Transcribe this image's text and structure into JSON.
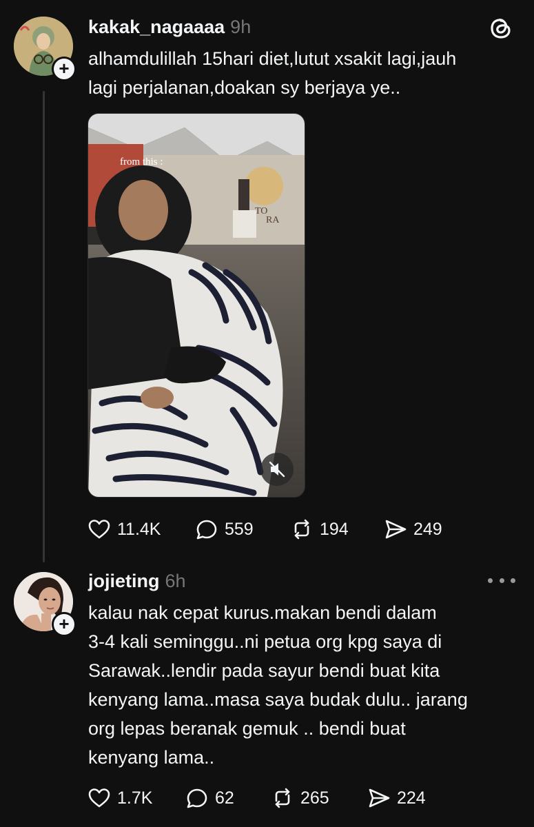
{
  "post": {
    "username": "kakak_nagaaaa",
    "time": "9h",
    "text_lines": [
      "alhamdulillah 15hari diet,lutut xsakit lagi,jauh",
      "lagi perjalanan,doakan sy berjaya ye.."
    ],
    "video": {
      "caption": "from this :",
      "sign_text_1": "TO",
      "sign_text_2": "RA"
    },
    "actions": {
      "likes": "11.4K",
      "comments": "559",
      "reposts": "194",
      "shares": "249"
    }
  },
  "reply": {
    "username": "jojieting",
    "time": "6h",
    "text_lines": [
      "kalau nak cepat kurus.makan bendi dalam",
      "3-4 kali seminggu..ni petua org kpg saya di",
      "Sarawak..lendir pada sayur bendi buat kita",
      "kenyang lama..masa saya budak dulu.. jarang",
      "org lepas beranak gemuk .. bendi buat",
      "kenyang lama.."
    ],
    "actions": {
      "likes": "1.7K",
      "comments": "62",
      "reposts": "265",
      "shares": "224"
    }
  },
  "icons": {
    "logo": "threads-logo-icon",
    "follow": "plus-icon",
    "like": "heart-icon",
    "comment": "comment-bubble-icon",
    "repost": "repost-icon",
    "share": "send-icon",
    "mute": "muted-speaker-icon",
    "more": "more-dots-icon"
  },
  "colors": {
    "background": "#101010",
    "text": "#f3f5f7",
    "secondary": "#777777",
    "thread_line": "#333638"
  }
}
